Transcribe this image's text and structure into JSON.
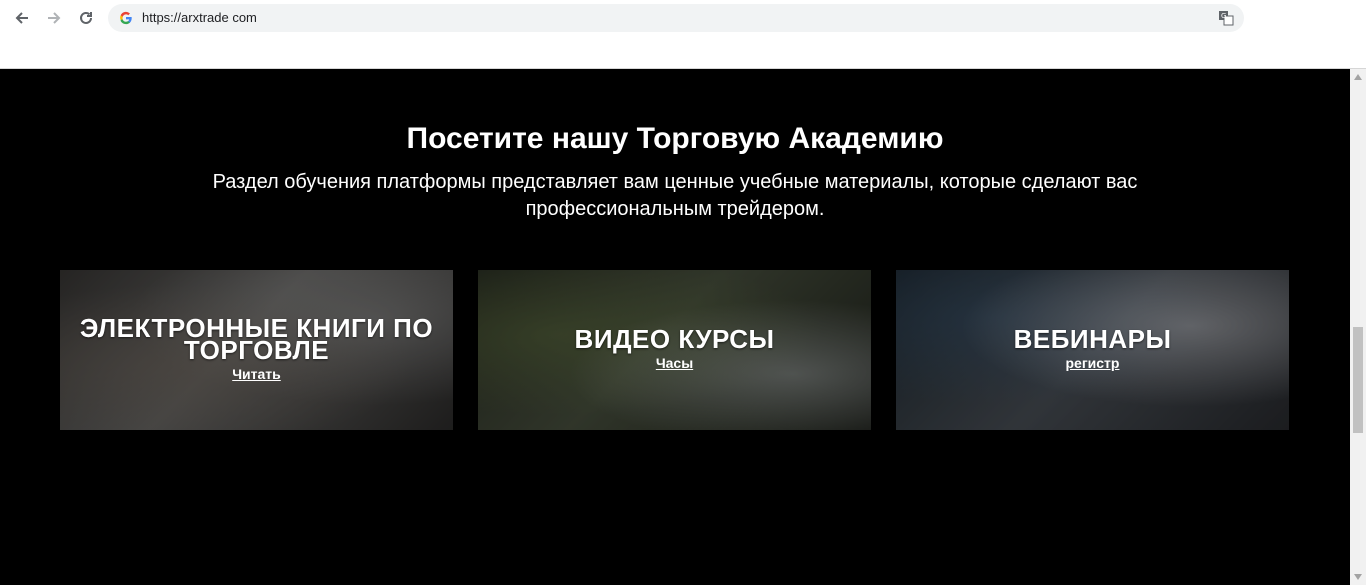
{
  "browser": {
    "url": "https://arxtrade com",
    "icons": {
      "back": "arrow-left-icon",
      "forward": "arrow-right-icon",
      "reload": "reload-icon",
      "site": "google-g-icon",
      "translate": "translate-icon"
    }
  },
  "academy": {
    "heading": "Посетите нашу Торговую Академию",
    "subtitle": "Раздел обучения платформы представляет вам ценные учебные материалы, которые сделают вас профессиональным трейдером.",
    "cards": [
      {
        "title": "ЭЛЕКТРОННЫЕ КНИГИ ПО ТОРГОВЛЕ",
        "link": "Читать"
      },
      {
        "title": "ВИДЕО КУРСЫ",
        "link": "Часы"
      },
      {
        "title": "ВЕБИНАРЫ",
        "link": "регистр"
      }
    ]
  }
}
